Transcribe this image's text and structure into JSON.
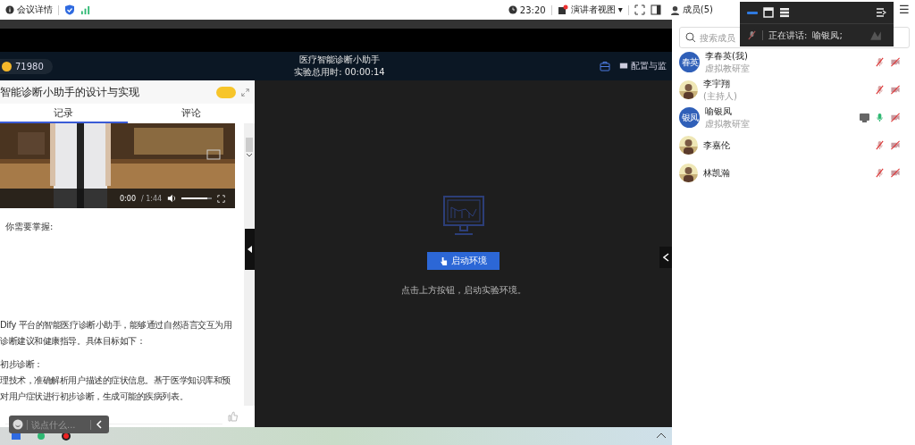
{
  "top_bar": {
    "meeting_info": "会议详情",
    "time": "23:20",
    "view_menu": "演讲者视图",
    "view_menu_caret": "▾",
    "members_button": "成员(5)",
    "menu": "☰"
  },
  "overlay": {
    "speaking_label": "正在讲话:",
    "speaker": "喻银凤;"
  },
  "header": {
    "points": "71980",
    "title": "医疗智能诊断小助手",
    "timer": "实验总用时: 00:00:14",
    "config": "配置与监"
  },
  "left_panel": {
    "title": "智能诊断小助手的设计与实现",
    "tabs": [
      {
        "label": "记录",
        "selected": true
      },
      {
        "label": "评论",
        "selected": false
      }
    ],
    "video": {
      "kind": "picture",
      "time": "0:00",
      "duration": "/ 1:44",
      "volume": {
        "level": 0.85
      }
    },
    "intro": "你需要掌握:",
    "lines": [
      "Dify 平台的智能医疗诊断小助手，能够通过自然语言交互为用",
      "诊断建议和健康指导。具体目标如下：",
      "初步诊断：",
      "理技术，准确解析用户描述的症状信息。基于医学知识库和预",
      "对用户症状进行初步诊断，生成可能的疾病列表。"
    ],
    "chat_placeholder": "说点什么..."
  },
  "stage": {
    "button": "启动环境",
    "hint": "点击上方按钮，启动实验环境。"
  },
  "members": {
    "search_placeholder": "搜索成员",
    "items": [
      {
        "name": "李春英(我)",
        "subtitle": "虚拟教研室",
        "initials": "春英",
        "screen_sharing": false,
        "mic_on": false
      },
      {
        "name": "李宇翔",
        "subtitle": "(主持人)",
        "screen_sharing": false,
        "mic_on": false
      },
      {
        "name": "喻银凤",
        "subtitle": "虚拟教研室",
        "initials": "银凤",
        "screen_sharing": true,
        "mic_on": true
      },
      {
        "name": "李嘉伦",
        "screen_sharing": false,
        "mic_on": false
      },
      {
        "name": "林凯瀚",
        "screen_sharing": false,
        "mic_on": false
      }
    ]
  }
}
